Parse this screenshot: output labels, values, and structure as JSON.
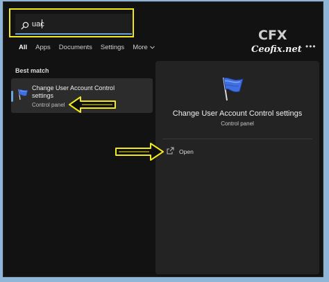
{
  "search": {
    "query": "uac"
  },
  "filters": [
    {
      "label": "All",
      "active": true
    },
    {
      "label": "Apps",
      "active": false
    },
    {
      "label": "Documents",
      "active": false
    },
    {
      "label": "Settings",
      "active": false
    },
    {
      "label": "More",
      "active": false
    }
  ],
  "watermark": {
    "logo": "CFX",
    "site": "Ceofix.net"
  },
  "results": {
    "section_title": "Best match",
    "best_match": {
      "title": "Change User Account Control settings",
      "subtitle": "Control panel",
      "icon": "uac-flag-icon"
    }
  },
  "detail": {
    "title": "Change User Account Control settings",
    "subtitle": "Control panel",
    "actions": [
      {
        "label": "Open",
        "icon": "open-icon"
      }
    ]
  },
  "colors": {
    "accent": "#6aa6d8",
    "highlight": "#f2ea1c",
    "panel_bg": "#121212",
    "detail_bg": "#232323"
  }
}
